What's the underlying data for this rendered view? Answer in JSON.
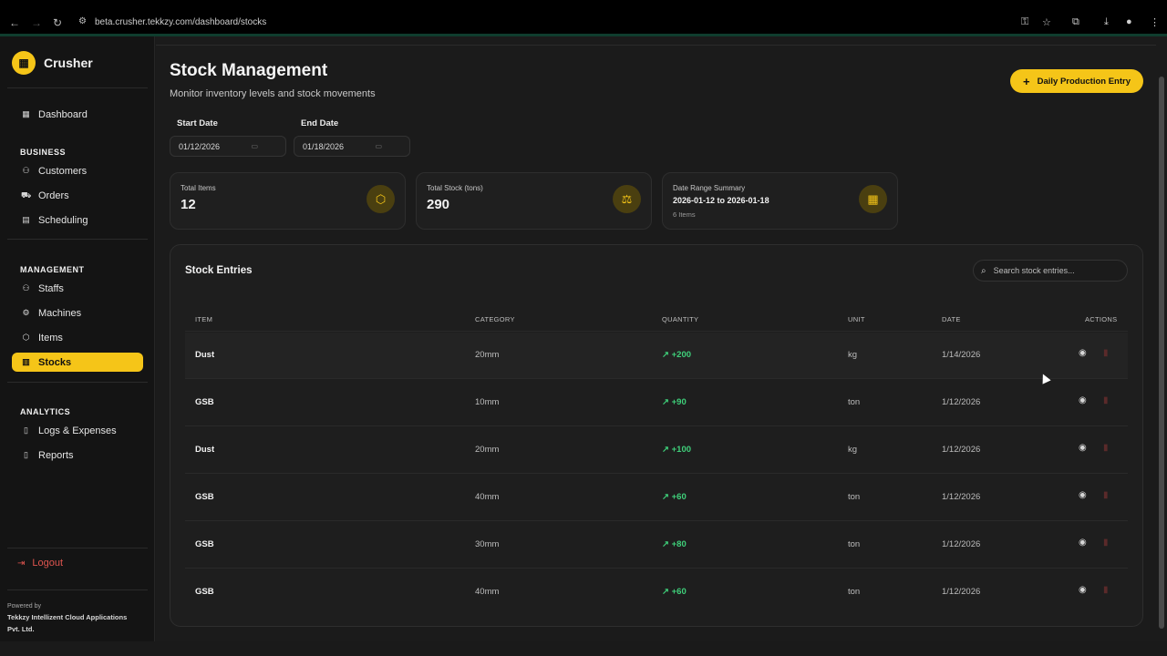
{
  "browser": {
    "url": "beta.crusher.tekkzy.com/dashboard/stocks"
  },
  "brand": {
    "name": "Crusher",
    "accent": "#f5c518"
  },
  "sidebar": {
    "dashboard": "Dashboard",
    "sections": [
      "BUSINESS",
      "MANAGEMENT",
      "ANALYTICS"
    ],
    "business": [
      "Customers",
      "Orders",
      "Scheduling"
    ],
    "management": [
      "Staffs",
      "Machines",
      "Items",
      "Stocks"
    ],
    "analytics": [
      "Logs & Expenses",
      "Reports"
    ],
    "active": "Stocks",
    "logout": "Logout",
    "powered_by": "Powered by",
    "company": "Tekkzy Intellizent Cloud Applications",
    "company2": "Pvt. Ltd."
  },
  "page": {
    "title": "Stock Management",
    "subtitle": "Monitor inventory levels and stock movements",
    "action": "Daily Production Entry"
  },
  "filters": {
    "start_label": "Start Date",
    "start_value": "01/12/2026",
    "end_label": "End Date",
    "end_value": "01/18/2026"
  },
  "stats": [
    {
      "label": "Total Items",
      "value": "12",
      "icon": "box-icon"
    },
    {
      "label": "Total Stock (tons)",
      "value": "290",
      "icon": "scale-icon"
    },
    {
      "label": "Date Range Summary",
      "value": "2026-01-12 to 2026-01-18",
      "sub": "6 Items",
      "icon": "calendar-icon"
    }
  ],
  "table": {
    "title": "Stock Entries",
    "search_placeholder": "Search stock entries...",
    "columns": [
      "ITEM",
      "CATEGORY",
      "QUANTITY",
      "UNIT",
      "DATE",
      "ACTIONS"
    ],
    "rows": [
      {
        "item": "Dust",
        "category": "20mm",
        "quantity": "+200",
        "unit": "kg",
        "date": "1/14/2026"
      },
      {
        "item": "GSB",
        "category": "10mm",
        "quantity": "+90",
        "unit": "ton",
        "date": "1/12/2026"
      },
      {
        "item": "Dust",
        "category": "20mm",
        "quantity": "+100",
        "unit": "kg",
        "date": "1/12/2026"
      },
      {
        "item": "GSB",
        "category": "40mm",
        "quantity": "+60",
        "unit": "ton",
        "date": "1/12/2026"
      },
      {
        "item": "GSB",
        "category": "30mm",
        "quantity": "+80",
        "unit": "ton",
        "date": "1/12/2026"
      },
      {
        "item": "GSB",
        "category": "40mm",
        "quantity": "+60",
        "unit": "ton",
        "date": "1/12/2026"
      }
    ]
  }
}
